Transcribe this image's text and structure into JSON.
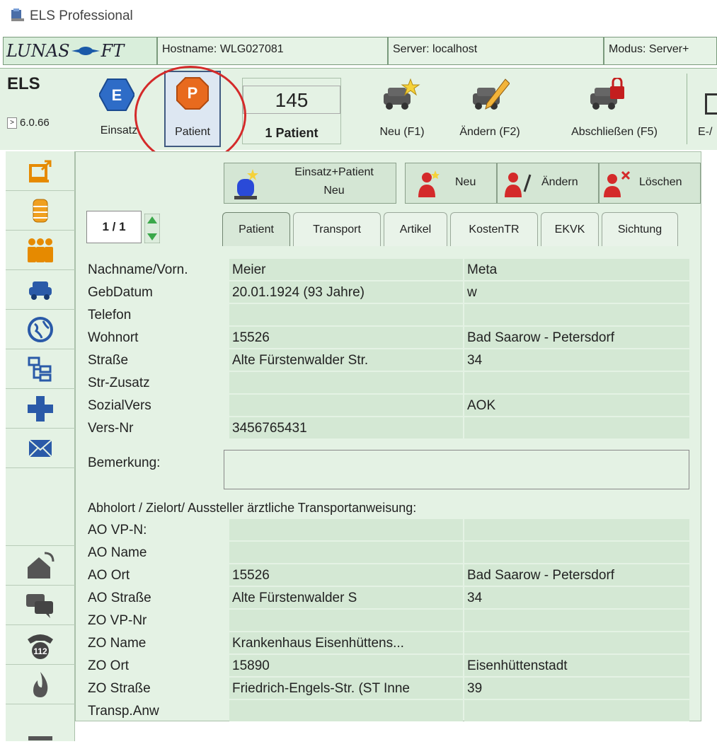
{
  "window": {
    "title": "ELS Professional"
  },
  "logo": {
    "text_left": "LUNAS",
    "text_right": "FT"
  },
  "infobar": {
    "hostname": "Hostname: WLG027081",
    "server": "Server: localhost",
    "modus": "Modus: Server+"
  },
  "toolbar": {
    "app": "ELS",
    "version": "6.0.66",
    "einsatz_label": "Einsatz",
    "einsatz_letter": "E",
    "patient_label": "Patient",
    "patient_letter": "P",
    "count": "145",
    "count_label": "1 Patient",
    "neu": "Neu (F1)",
    "aendern": "Ändern (F2)",
    "abschliessen": "Abschließen (F5)",
    "extra": "E-/"
  },
  "actions": {
    "einsatz_patient_line1": "Einsatz+Patient",
    "einsatz_patient_line2": "Neu",
    "neu": "Neu",
    "aendern": "Ändern",
    "loeschen": "Löschen"
  },
  "pager": {
    "value": "1 / 1"
  },
  "tabs": [
    "Patient",
    "Transport",
    "Artikel",
    "KostenTR",
    "EKVK",
    "Sichtung"
  ],
  "patient": [
    {
      "label": "Nachname/Vorn.",
      "v1": "Meier",
      "v2": "Meta"
    },
    {
      "label": "GebDatum",
      "v1": "20.01.1924  (93 Jahre)",
      "v2": "w"
    },
    {
      "label": "Telefon",
      "v1": "",
      "v2": ""
    },
    {
      "label": "Wohnort",
      "v1": "15526",
      "v2": "Bad Saarow - Petersdorf"
    },
    {
      "label": "Straße",
      "v1": "Alte Fürstenwalder Str.",
      "v2": "34"
    },
    {
      "label": "Str-Zusatz",
      "v1": "",
      "v2": ""
    },
    {
      "label": "SozialVers",
      "v1": "",
      "v2": "AOK"
    },
    {
      "label": "Vers-Nr",
      "v1": "3456765431",
      "v2": ""
    }
  ],
  "bemerkung_label": "Bemerkung:",
  "section_title": "Abholort / Zielort/ Aussteller ärztliche Transportanweisung:",
  "transport": [
    {
      "label": "AO VP-N:",
      "v1": "",
      "v2": ""
    },
    {
      "label": "AO Name",
      "v1": "",
      "v2": ""
    },
    {
      "label": "AO Ort",
      "v1": "15526",
      "v2": "Bad Saarow - Petersdorf"
    },
    {
      "label": "AO Straße",
      "v1": "Alte Fürstenwalder S",
      "v2": "34"
    },
    {
      "label": "ZO VP-Nr",
      "v1": "",
      "v2": ""
    },
    {
      "label": "ZO Name",
      "v1": "Krankenhaus Eisenhüttens...",
      "v2": ""
    },
    {
      "label": "ZO Ort",
      "v1": "15890",
      "v2": "Eisenhüttenstadt"
    },
    {
      "label": "ZO Straße",
      "v1": "Friedrich-Engels-Str. (ST Inne",
      "v2": "39"
    },
    {
      "label": "Transp.Anw",
      "v1": "",
      "v2": ""
    }
  ],
  "sidebar_icons": [
    "computer-export-icon",
    "database-icon",
    "people-icon",
    "car-icon",
    "globe-icon",
    "tree-icon",
    "medical-cross-icon",
    "mail-icon",
    "home-phone-icon",
    "chat-icon",
    "emergency-phone-112-icon",
    "fire-icon"
  ],
  "sidebar_112": "112",
  "colors": {
    "panel": "#e4f2e4",
    "field": "#d4e8d4",
    "highlight_circle": "#d42a2a",
    "badge_blue": "#2e6cc7",
    "badge_orange": "#e86a1e"
  }
}
